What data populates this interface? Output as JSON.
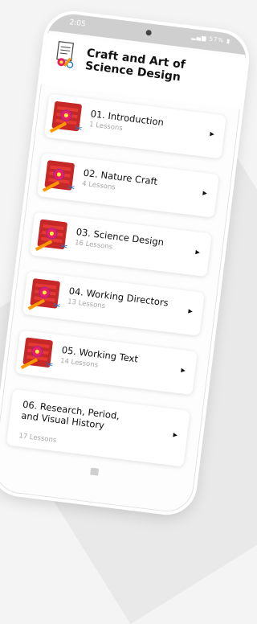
{
  "status_bar": {
    "time": "2:05",
    "battery": "57%"
  },
  "header": {
    "title": "Craft and Art of Science Design"
  },
  "lessons": [
    {
      "title": "01. Introduction",
      "count": "1 Lessons"
    },
    {
      "title": "02. Nature Craft",
      "count": "4 Lessons"
    },
    {
      "title": "03. Science Design",
      "count": "16 Lessons"
    },
    {
      "title": "04. Working Directors",
      "count": "13 Lessons"
    },
    {
      "title": "05. Working Text",
      "count": "14 Lessons"
    },
    {
      "title": "06. Research, Period, and Visual History",
      "count": "17 Lessons"
    }
  ],
  "icons": {
    "arrow": "chevron-right-icon",
    "thumb": "craft-art-icon",
    "logo": "app-logo-icon"
  },
  "colors": {
    "accent": "#c62828",
    "muted_text": "#a8a8a8",
    "status_bar": "#cfcfcf"
  }
}
